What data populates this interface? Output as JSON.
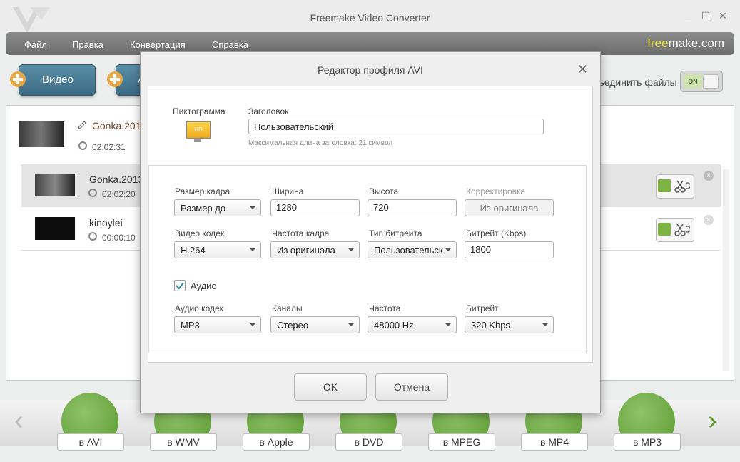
{
  "window": {
    "title": "Freemake Video Converter",
    "minimize": "_",
    "maximize": "☐",
    "close": "✕"
  },
  "menu": {
    "items": [
      "Файл",
      "Правка",
      "Конвертация",
      "Справка"
    ],
    "brand_free": "free",
    "brand_make": "make.com"
  },
  "toolbar": {
    "video_label": "Видео",
    "audio_label": "А",
    "join_label": "ъединить файлы",
    "toggle_label": "ON"
  },
  "files": {
    "header": {
      "name": "Gonka.201",
      "duration": "02:02:31"
    },
    "rows": [
      {
        "name": "Gonka.2013.",
        "duration": "02:02:20"
      },
      {
        "name": "kinoylei",
        "duration": "00:00:10"
      }
    ]
  },
  "formats": [
    "в AVI",
    "в WMV",
    "в Apple",
    "в DVD",
    "в MPEG",
    "в MP4",
    "в MP3"
  ],
  "dialog": {
    "title": "Редактор профиля AVI",
    "icon_label": "Пиктограмма",
    "icon_badge": "HD",
    "header_label": "Заголовок",
    "header_value": "Пользовательский",
    "header_hint": "Максимальная длина заголовка: 21 символ",
    "video": {
      "frame_size_label": "Размер кадра",
      "frame_size_value": "Размер до",
      "width_label": "Ширина",
      "width_value": "1280",
      "height_label": "Высота",
      "height_value": "720",
      "correction_label": "Корректировка",
      "correction_value": "Из оригинала",
      "codec_label": "Видео кодек",
      "codec_value": "H.264",
      "fps_label": "Частота кадра",
      "fps_value": "Из оригинала",
      "bitrate_type_label": "Тип битрейта",
      "bitrate_type_value": "Пользовательск",
      "bitrate_label": "Битрейт (Kbps)",
      "bitrate_value": "1800"
    },
    "audio": {
      "checkbox_label": "Аудио",
      "codec_label": "Аудио кодек",
      "codec_value": "MP3",
      "channels_label": "Каналы",
      "channels_value": "Стерео",
      "freq_label": "Частота",
      "freq_value": "48000 Hz",
      "bitrate_label": "Битрейт",
      "bitrate_value": "320 Kbps"
    },
    "ok_label": "OK",
    "cancel_label": "Отмена"
  },
  "colors": {
    "accent_blue": "#3a6983",
    "play_green": "#7cb342",
    "brand_yellow": "#e8e44a"
  }
}
